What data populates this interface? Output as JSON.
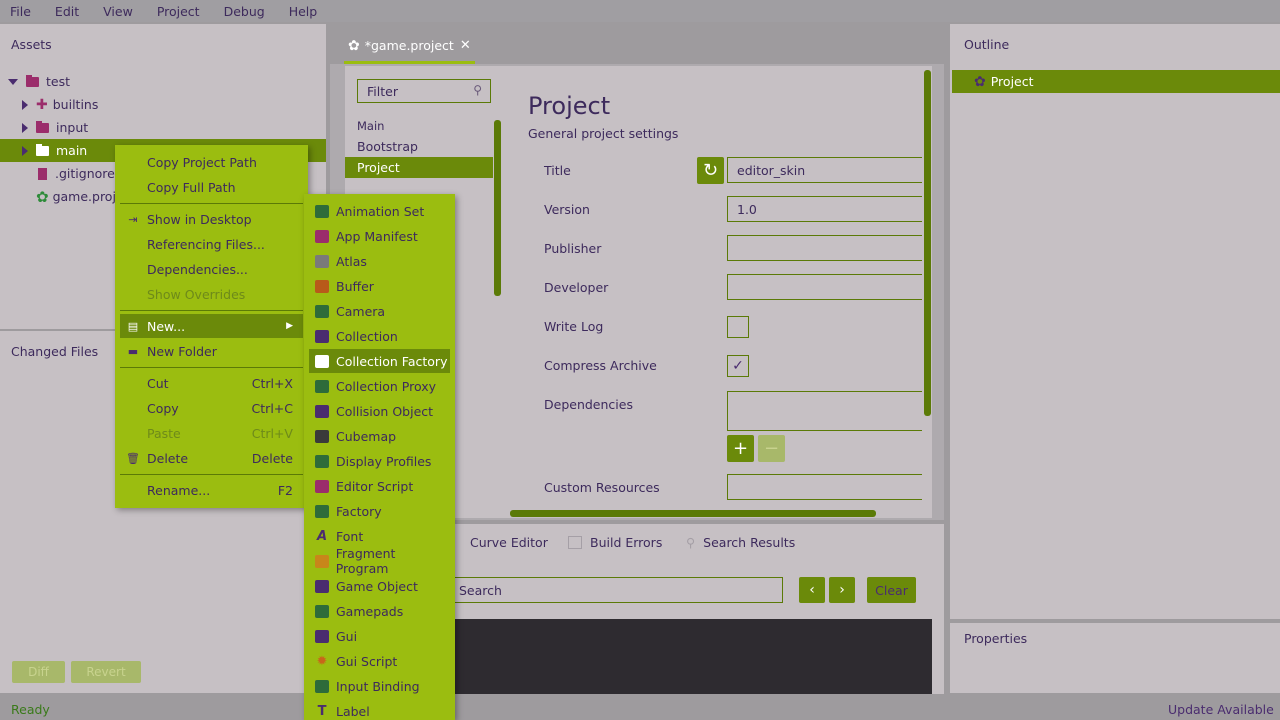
{
  "menubar": [
    "File",
    "Edit",
    "View",
    "Project",
    "Debug",
    "Help"
  ],
  "assets": {
    "title": "Assets",
    "tree": [
      "test",
      "builtins",
      "input",
      "main",
      ".gitignore",
      "game.project"
    ]
  },
  "changed_files": {
    "title": "Changed Files",
    "diff_label": "Diff",
    "revert_label": "Revert"
  },
  "editor": {
    "tab_title": "*game.project",
    "filter_placeholder": "Filter",
    "nav": [
      "Main",
      "Bootstrap",
      "Project"
    ],
    "section_title": "Project",
    "section_subtitle": "General project settings",
    "fields": {
      "title_label": "Title",
      "title_value": "editor_skin",
      "version_label": "Version",
      "version_value": "1.0",
      "publisher_label": "Publisher",
      "developer_label": "Developer",
      "write_log_label": "Write Log",
      "compress_label": "Compress Archive",
      "compress_checked": "✓",
      "dependencies_label": "Dependencies",
      "custom_resources_label": "Custom Resources"
    }
  },
  "bottom": {
    "tabs": [
      "Curve Editor",
      "Build Errors",
      "Search Results"
    ],
    "search_placeholder": "Search",
    "clear_label": "Clear"
  },
  "outline": {
    "title": "Outline",
    "item": "Project"
  },
  "properties": {
    "title": "Properties"
  },
  "status": {
    "left": "Ready",
    "right": "Update Available"
  },
  "context_menu": {
    "items": [
      {
        "label": "Copy Project Path",
        "shortcut": ""
      },
      {
        "label": "Copy Full Path",
        "shortcut": ""
      },
      {
        "label": "Show in Desktop",
        "shortcut": ""
      },
      {
        "label": "Referencing Files...",
        "shortcut": ""
      },
      {
        "label": "Dependencies...",
        "shortcut": ""
      },
      {
        "label": "Show Overrides",
        "shortcut": ""
      },
      {
        "label": "New...",
        "shortcut": ""
      },
      {
        "label": "New Folder",
        "shortcut": ""
      },
      {
        "label": "Cut",
        "shortcut": "Ctrl+X"
      },
      {
        "label": "Copy",
        "shortcut": "Ctrl+C"
      },
      {
        "label": "Paste",
        "shortcut": "Ctrl+V"
      },
      {
        "label": "Delete",
        "shortcut": "Delete"
      },
      {
        "label": "Rename...",
        "shortcut": "F2"
      }
    ]
  },
  "submenu": {
    "items": [
      "Animation Set",
      "App Manifest",
      "Atlas",
      "Buffer",
      "Camera",
      "Collection",
      "Collection Factory",
      "Collection Proxy",
      "Collision Object",
      "Cubemap",
      "Display Profiles",
      "Editor Script",
      "Factory",
      "Font",
      "Fragment Program",
      "Game Object",
      "Gamepads",
      "Gui",
      "Gui Script",
      "Input Binding",
      "Label"
    ],
    "highlighted": "Collection Factory"
  },
  "colors": {
    "accent": "#9bbd10",
    "selection": "#6b8a0a",
    "text": "#3d2a5c",
    "panel": "#c6c0c4"
  }
}
